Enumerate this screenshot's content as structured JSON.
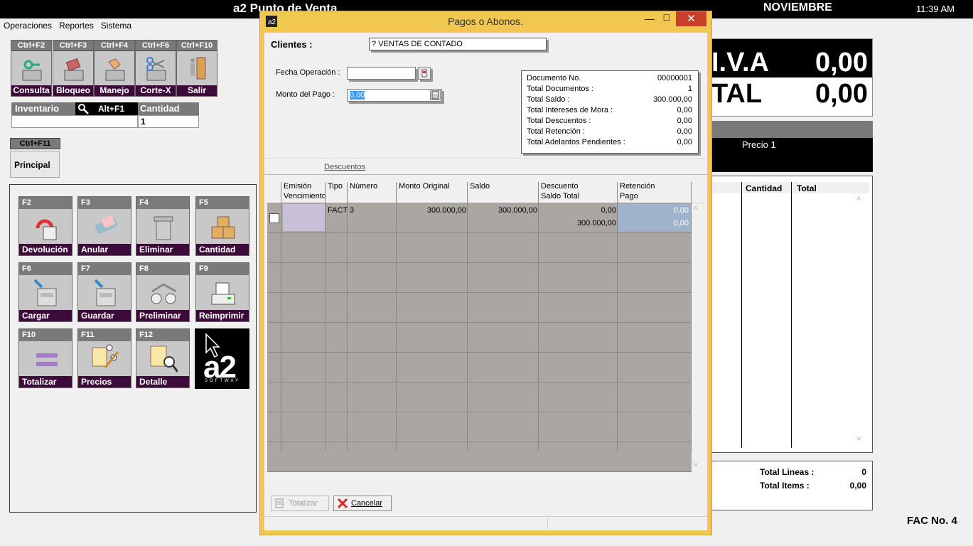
{
  "app_title": "a2 Punto de Venta",
  "month": "NOVIEMBRE",
  "time": "11:39 AM",
  "menu": [
    "Operaciones",
    "Reportes",
    "Sistema"
  ],
  "top_keys": [
    {
      "key": "Ctrl+F2",
      "label": "Consulta"
    },
    {
      "key": "Ctrl+F3",
      "label": "Bloqueo"
    },
    {
      "key": "Ctrl+F4",
      "label": "Manejo"
    },
    {
      "key": "Ctrl+F6",
      "label": "Corte-X"
    },
    {
      "key": "Ctrl+F10",
      "label": "Salir"
    }
  ],
  "inventory": {
    "label": "Inventario",
    "shortcut": "Alt+F1",
    "qty_label": "Cantidad",
    "qty_value": "1"
  },
  "principal": {
    "key": "Ctrl+F11",
    "label": "Principal"
  },
  "fkeys": [
    {
      "key": "F2",
      "label": "Devolución"
    },
    {
      "key": "F3",
      "label": "Anular"
    },
    {
      "key": "F4",
      "label": "Eliminar"
    },
    {
      "key": "F5",
      "label": "Cantidad"
    },
    {
      "key": "F6",
      "label": "Cargar"
    },
    {
      "key": "F7",
      "label": "Guardar"
    },
    {
      "key": "F8",
      "label": "Preliminar"
    },
    {
      "key": "F9",
      "label": "Reimprimir"
    },
    {
      "key": "F10",
      "label": "Totalizar"
    },
    {
      "key": "F11",
      "label": "Precios"
    },
    {
      "key": "F12",
      "label": "Detalle"
    }
  ],
  "logo_text": "a2",
  "logo_sub": "SOFTWAY",
  "totals_panel": {
    "iva_label": "I.V.A",
    "iva_value": "0,00",
    "total_label": "TAL",
    "total_value": "0,00",
    "price_label": "Precio 1"
  },
  "items_table": {
    "headers": [
      "Cantidad",
      "Total"
    ]
  },
  "summary": {
    "lines_label": "Total Lineas :",
    "lines_value": "0",
    "items_label": "Total Items :",
    "items_value": "0,00"
  },
  "fac_no": "FAC No. 4",
  "dialog": {
    "title": "Pagos o Abonos.",
    "clients_label": "Clientes  :",
    "clients_value": "? VENTAS DE CONTADO",
    "fecha_label": "Fecha Operación :",
    "fecha_value": "",
    "monto_label": "Monto del Pago :",
    "monto_value": "0,00",
    "info": [
      {
        "label": "Documento No.",
        "value": "00000001"
      },
      {
        "label": "Total Documentos :",
        "value": "1"
      },
      {
        "label": "Total Saldo :",
        "value": "300.000,00"
      },
      {
        "label": "Total Intereses de Mora :",
        "value": "0,00"
      },
      {
        "label": "Total Descuentos :",
        "value": "0,00"
      },
      {
        "label": "Total Retención  :",
        "value": "0,00"
      },
      {
        "label": "Total Adelantos Pendientes :",
        "value": "0,00"
      }
    ],
    "tab_descuentos": "Descuentos",
    "grid_headers": {
      "emision": "Emisión",
      "vencimiento": "Vencimiento",
      "tipo": "Tipo",
      "numero": "Número",
      "monto_original": "Monto Original",
      "saldo": "Saldo",
      "descuento": "Descuento",
      "saldo_total": "Saldo Total",
      "retencion": "Retención",
      "pago": "Pago"
    },
    "row": {
      "tipo": "FACT",
      "numero": "3",
      "monto_original": "300.000,00",
      "saldo": "300.000,00",
      "descuento": "0,00",
      "saldo_total": "300.000,00",
      "retencion": "0,00",
      "pago": "0,00"
    },
    "btn_totalizar": "Totalizar",
    "btn_cancelar": "Cancelar"
  }
}
